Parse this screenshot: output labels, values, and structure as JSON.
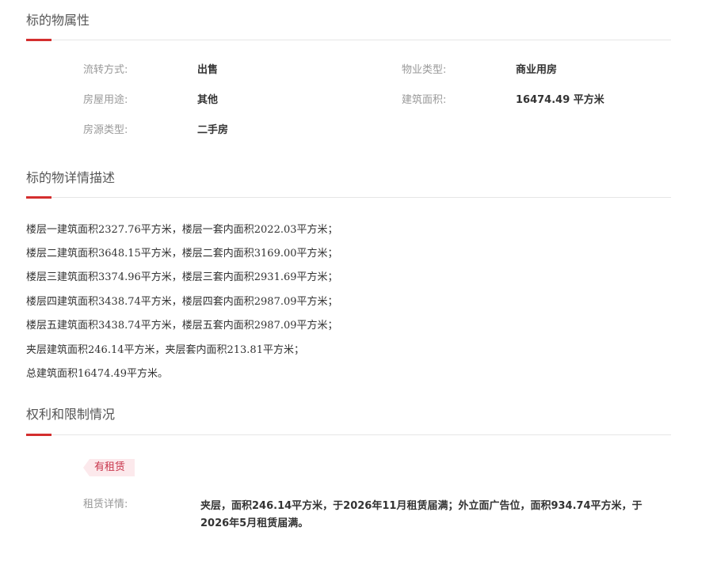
{
  "sections": {
    "attributes": {
      "title": "标的物属性"
    },
    "description": {
      "title": "标的物详情描述"
    },
    "rights": {
      "title": "权利和限制情况"
    }
  },
  "attributes": {
    "transfer_method": {
      "label": "流转方式:",
      "value": "出售"
    },
    "property_type": {
      "label": "物业类型:",
      "value": "商业用房"
    },
    "house_use": {
      "label": "房屋用途:",
      "value": "其他"
    },
    "building_area": {
      "label": "建筑面积:",
      "value": "16474.49 平方米"
    },
    "source_type": {
      "label": "房源类型:",
      "value": "二手房"
    }
  },
  "description_lines": [
    "楼层一建筑面积2327.76平方米，楼层一套内面积2022.03平方米；",
    "楼层二建筑面积3648.15平方米，楼层二套内面积3169.00平方米；",
    "楼层三建筑面积3374.96平方米，楼层三套内面积2931.69平方米；",
    "楼层四建筑面积3438.74平方米，楼层四套内面积2987.09平方米；",
    "楼层五建筑面积3438.74平方米，楼层五套内面积2987.09平方米；",
    "夹层建筑面积246.14平方米，夹层套内面积213.81平方米；",
    "总建筑面积16474.49平方米。"
  ],
  "rights": {
    "tag": "有租赁",
    "lease_label": "租赁详情:",
    "lease_detail": "夹层，面积246.14平方米，于2026年11月租赁届满；外立面广告位，面积934.74平方米，于2026年5月租赁届满。"
  },
  "colors": {
    "accent": "#d42e2e",
    "tag_text": "#c8354b",
    "tag_bg": "#fce9ec",
    "label": "#999999",
    "text": "#333333"
  }
}
